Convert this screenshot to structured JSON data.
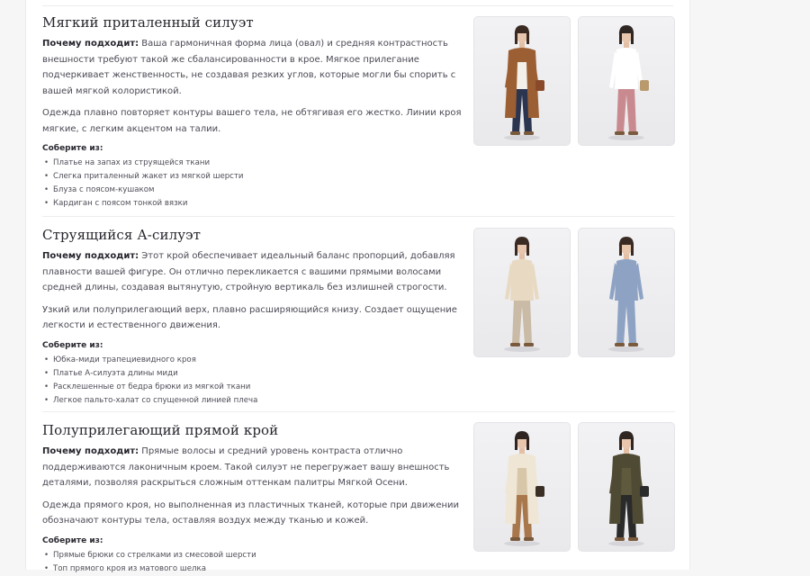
{
  "sections": [
    {
      "title": "Мягкий приталенный силуэт",
      "why_label": "Почему подходит:",
      "why_text": " Ваша гармоничная форма лица (овал) и средняя контрастность внешности требуют такой же сбалансированности в крое. Мягкое прилегание подчеркивает женственность, не создавая резких углов, которые могли бы спорить с вашей мягкой колористикой.",
      "desc": "Одежда плавно повторяет контуры вашего тела, не обтягивая его жестко. Линии кроя мягкие, с легким акцентом на талии.",
      "assemble_label": "Соберите из:",
      "items": [
        "Платье на запах из струящейся ткани",
        "Слегка приталенный жакет из мягкой шерсти",
        "Блуза с поясом-кушаком",
        "Кардиган с поясом тонкой вязки"
      ]
    },
    {
      "title": "Струящийся А-силуэт",
      "why_label": "Почему подходит:",
      "why_text": " Этот крой обеспечивает идеальный баланс пропорций, добавляя плавности вашей фигуре. Он отлично перекликается с вашими прямыми волосами средней длины, создавая вытянутую, стройную вертикаль без излишней строгости.",
      "desc": "Узкий или полуприлегающий верх, плавно расширяющийся книзу. Создает ощущение легкости и естественного движения.",
      "assemble_label": "Соберите из:",
      "items": [
        "Юбка-миди трапециевидного кроя",
        "Платье А-силуэта длины миди",
        "Расклешенные от бедра брюки из мягкой ткани",
        "Легкое пальто-халат со спущенной линией плеча"
      ]
    },
    {
      "title": "Полуприлегающий прямой крой",
      "why_label": "Почему подходит:",
      "why_text": " Прямые волосы и средний уровень контраста отлично поддерживаются лаконичным кроем. Такой силуэт не перегружает вашу внешность деталями, позволяя раскрыться сложным оттенкам палитры Мягкой Осени.",
      "desc": "Одежда прямого кроя, но выполненная из пластичных тканей, которые при движении обозначают контуры тела, оставляя воздух между тканью и кожей.",
      "assemble_label": "Соберите из:",
      "items": [
        "Прямые брюки со стрелками из смесовой шерсти",
        "Топ прямого кроя из матового шелка"
      ]
    }
  ],
  "photos": [
    {
      "name": "model-brown-coat-photo",
      "top": "#f3efe9",
      "bottom": "#2b3550",
      "coat": "#9b5f33",
      "hair": "#3a2a22",
      "bag": "#8a4a2a"
    },
    {
      "name": "model-floral-skirt-photo",
      "top": "#ffffff",
      "bottom": "#c98a8f",
      "coat": "",
      "hair": "#2d2622",
      "bag": "#b99a6d"
    },
    {
      "name": "model-pleated-skirt-photo",
      "top": "#e8d9c2",
      "bottom": "#c9bba5",
      "coat": "",
      "hair": "#3b2a22",
      "bag": ""
    },
    {
      "name": "model-blue-dress-photo",
      "top": "#8ea3c4",
      "bottom": "#8ea3c4",
      "coat": "",
      "hair": "#3a2a24",
      "bag": ""
    },
    {
      "name": "model-trench-coat-photo",
      "top": "#d8c6a8",
      "bottom": "#a9774c",
      "coat": "#efe6d6",
      "hair": "#2f2420",
      "bag": "#3b2e25"
    },
    {
      "name": "model-olive-coat-photo",
      "top": "#5f5a3e",
      "bottom": "#2a2a2a",
      "coat": "#4f4a33",
      "hair": "#2f2622",
      "bag": "#2b2b2b"
    }
  ]
}
